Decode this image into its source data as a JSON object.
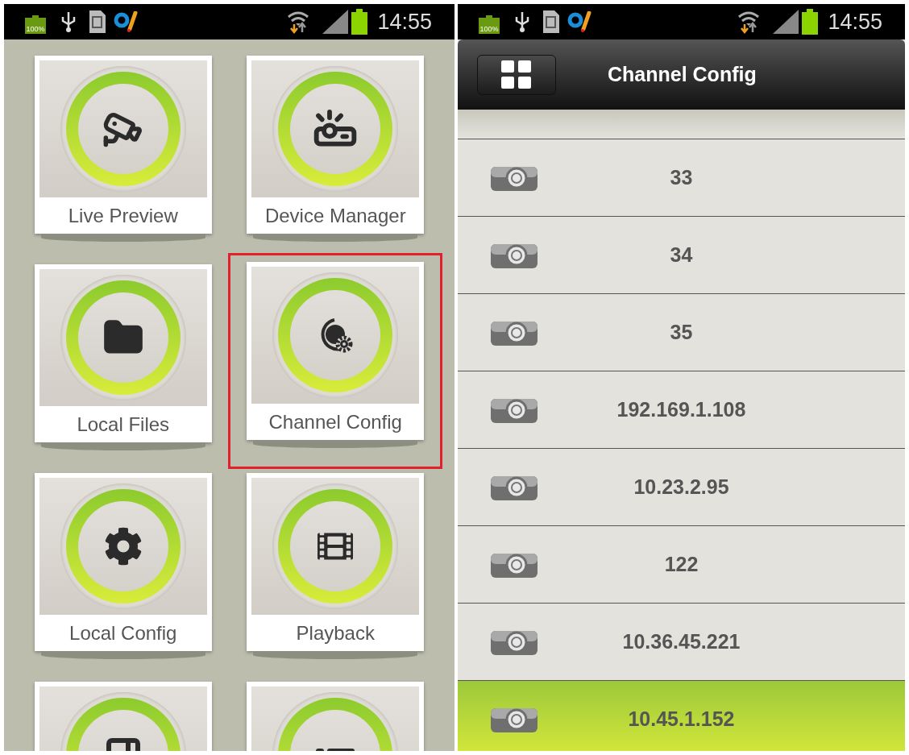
{
  "left_screen": {
    "status_bar": {
      "battery_percent": "100%",
      "time": "14:55"
    },
    "tiles": [
      {
        "kind": "camera",
        "label": "Live Preview",
        "highlighted": false
      },
      {
        "kind": "projector",
        "label": "Device Manager",
        "highlighted": false
      },
      {
        "kind": "folder",
        "label": "Local Files",
        "highlighted": false
      },
      {
        "kind": "channel",
        "label": "Channel Config",
        "highlighted": true
      },
      {
        "kind": "gear",
        "label": "Local Config",
        "highlighted": false
      },
      {
        "kind": "film",
        "label": "Playback",
        "highlighted": false
      },
      {
        "kind": "window"
      },
      {
        "kind": "list"
      }
    ]
  },
  "right_screen": {
    "status_bar": {
      "battery_percent": "100%",
      "time": "14:55"
    },
    "header": {
      "title": "Channel Config"
    },
    "channels": [
      {
        "label": "33",
        "selected": false
      },
      {
        "label": "34",
        "selected": false
      },
      {
        "label": "35",
        "selected": false
      },
      {
        "label": "192.169.1.108",
        "selected": false
      },
      {
        "label": "10.23.2.95",
        "selected": false
      },
      {
        "label": "122",
        "selected": false
      },
      {
        "label": "10.36.45.221",
        "selected": false
      },
      {
        "label": "10.45.1.152",
        "selected": true
      }
    ]
  }
}
